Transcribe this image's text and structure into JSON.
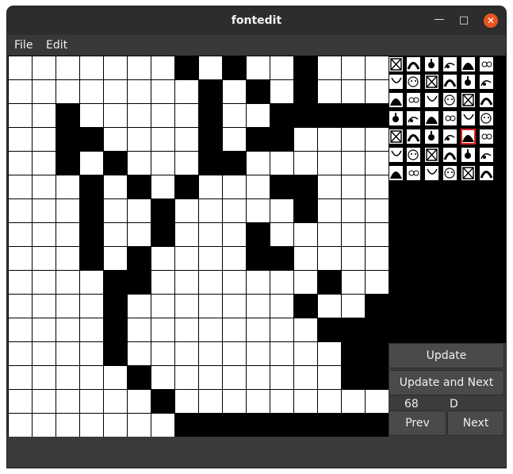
{
  "window": {
    "title": "fontedit"
  },
  "menu": {
    "file": "File",
    "edit": "Edit"
  },
  "glyph_grid": {
    "columns": 16,
    "rows_count": 16,
    "rows": [
      "0000000101001000",
      "0000000010101000",
      "0010000010011111",
      "0011000010110000",
      "0010100011000000",
      "0001010100011000",
      "0001001000001000",
      "0001001000100000",
      "0001010000110000",
      "0000110000000100",
      "0000100000001001",
      "0000100000000111",
      "0000100000000011",
      "0000010000000011",
      "0000001000000000",
      "0000000111111111"
    ]
  },
  "preview": {
    "selected_row": 4,
    "selected_col": 4
  },
  "controls": {
    "update": "Update",
    "update_and_next": "Update and Next",
    "char_code": "68",
    "char": "D",
    "prev": "Prev",
    "next": "Next"
  }
}
